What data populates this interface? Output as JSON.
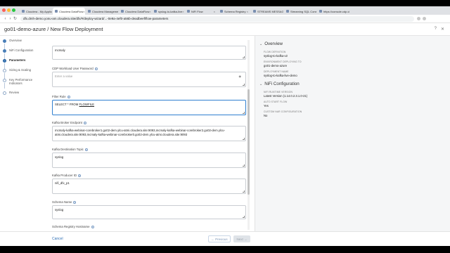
{
  "browser": {
    "tabs": [
      {
        "label": "Cloudera - My Applications",
        "active": false
      },
      {
        "label": "Cloudera DataFlow",
        "active": true
      },
      {
        "label": "Cloudera Management Cons",
        "active": false
      },
      {
        "label": "Cloudera DataFlow",
        "active": false
      },
      {
        "label": "syslog-to-kafka-live",
        "active": false
      },
      {
        "label": "NiFi Flow",
        "active": false
      },
      {
        "label": "Schema Registry",
        "active": false
      },
      {
        "label": "STREAMS MESSAGING MA",
        "active": false
      },
      {
        "label": "Streaming SQL Console",
        "active": false
      },
      {
        "label": "https://console.cdp.cloudera",
        "active": false
      }
    ],
    "url": "dfx.dmh-demo.yonu-am.cloudera.site/dfx/#/deploy-wizard/...-0e9a-4ef0-a56b-deadbeef/flow-parameters"
  },
  "header": {
    "title": "go01-demo-azure / New Flow Deployment"
  },
  "steps": [
    {
      "label": "Overview",
      "state": "done"
    },
    {
      "label": "NiFi Configuration",
      "state": "done"
    },
    {
      "label": "Parameters",
      "state": "active"
    },
    {
      "label": "Sizing & Scaling",
      "state": "todo"
    },
    {
      "label": "Key Performance Indicators",
      "state": "todo"
    },
    {
      "label": "Review",
      "state": "todo"
    }
  ],
  "form": {
    "user_value": "mcmaly",
    "password_label": "CDP Workload User Password",
    "password_placeholder": "Enter a value",
    "filter_rule_label": "Filter Rule",
    "filter_rule_value_pre": "SELECT * FROM ",
    "filter_rule_value_flow": "FLOWFILE",
    "brokers_label": "Kafka Broker Endpoint",
    "brokers_value": "mcmaly-kafka-webinar-corebroker1.go02-dem.ylcu-atmi.cloudera.site:9093,mcmaly-kafka-webinar-corebroker2.go02-dem.ylcu-atmi.cloudera.site:9093,mcmaly-kafka-webinar-corebroker0.go02-dem.ylcu-atmi.cloudera.site:9093",
    "dest_topic_label": "Kafka Destination Topic",
    "dest_topic_value": "syslog",
    "producer_id_label": "Kafka Producer ID",
    "producer_id_value": "nifi_dfx_p1",
    "schema_name_label": "Schema Name",
    "schema_name_value": "syslog",
    "schema_registry_label": "Schema Registry Hostname"
  },
  "overview": {
    "title": "Overview",
    "items": [
      {
        "key": "FLOW DEFINITION",
        "value": "syslog-to-kafka-v2"
      },
      {
        "key": "ENVIRONMENT DEPLOYING TO",
        "value": "go01-demo-azure"
      },
      {
        "key": "DEPLOYMENT NAME",
        "value": "syslog-to-kafka-live-demo"
      }
    ],
    "nifi_title": "NiFi Configuration",
    "nifi_items": [
      {
        "key": "NIFI RUNTIME VERSION",
        "value": "Latest Version (1.14.0.2.3.1.0-21)"
      },
      {
        "key": "AUTO START FLOW",
        "value": "Yes"
      },
      {
        "key": "CUSTOM NAR CONFIGURATION",
        "value": "No"
      }
    ]
  },
  "footer": {
    "cancel": "Cancel",
    "previous": "← Previous",
    "next": "Next →"
  }
}
